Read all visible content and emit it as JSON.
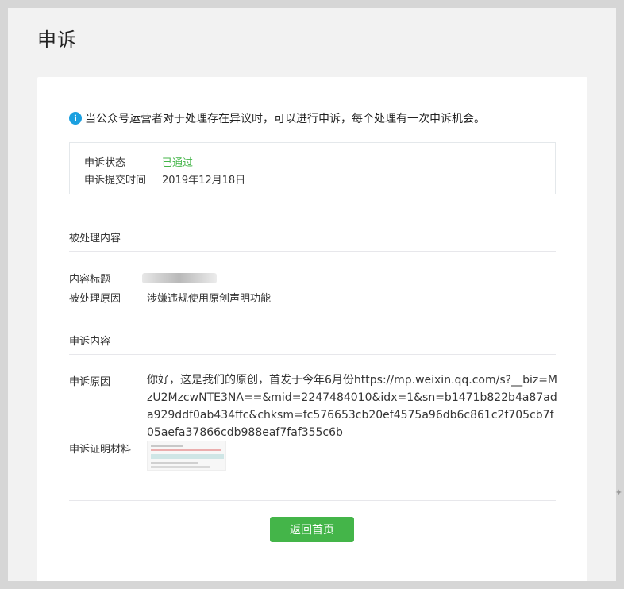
{
  "page": {
    "title": "申诉"
  },
  "notice": {
    "icon": "info-icon",
    "text": "当公众号运营者对于处理存在异议时，可以进行申诉，每个处理有一次申诉机会。"
  },
  "status": {
    "state_label": "申诉状态",
    "state_value": "已通过",
    "state_color": "#44b549",
    "time_label": "申诉提交时间",
    "time_value": "2019年12月18日"
  },
  "processed": {
    "section_title": "被处理内容",
    "title_label": "内容标题",
    "reason_label": "被处理原因",
    "reason_value": "涉嫌违规使用原创声明功能"
  },
  "appeal": {
    "section_title": "申诉内容",
    "reason_label": "申诉原因",
    "reason_value": "你好，这是我们的原创，首发于今年6月份https://mp.weixin.qq.com/s?__biz=MzU2MzcwNTE3NA==&mid=2247484010&idx=1&sn=b1471b822b4a87ada929ddf0ab434ffc&chksm=fc576653cb20ef4575a96db6c861c2f705cb7f05aefa37866cdb988eaf7faf355c6b",
    "proof_label": "申诉证明材料"
  },
  "actions": {
    "home_button": "返回首页",
    "button_color": "#44b549"
  }
}
